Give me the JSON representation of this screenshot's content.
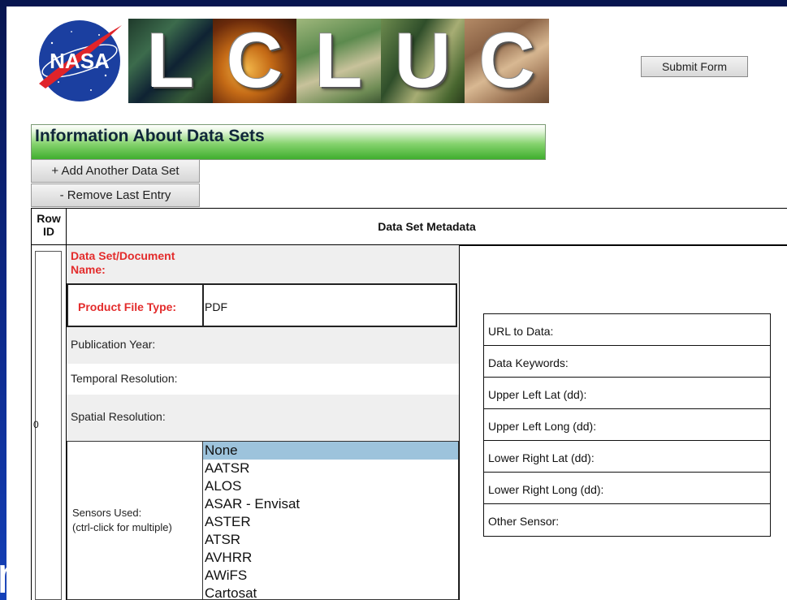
{
  "header": {
    "logo_text": "NASA",
    "banner_letters": [
      "L",
      "C",
      "L",
      "U",
      "C"
    ],
    "submit_label": "Submit Form"
  },
  "section": {
    "title": "Information About Data Sets",
    "add_label": "+ Add Another Data Set",
    "remove_label": "- Remove Last Entry"
  },
  "table": {
    "rowid_header": "Row ID",
    "meta_header": "Data Set Metadata",
    "row_id": "0",
    "fields": {
      "name_label": "Data Set/Document Name:",
      "file_type_label": "Product File Type:",
      "file_type_value": "PDF",
      "pub_year_label": "Publication Year:",
      "temporal_label": "Temporal Resolution:",
      "spatial_label": "Spatial Resolution:",
      "sensors_label": "Sensors Used:",
      "sensors_hint": "(ctrl-click for multiple)"
    },
    "sensors": [
      "None",
      "AATSR",
      "ALOS",
      "ASAR - Envisat",
      "ASTER",
      "ATSR",
      "AVHRR",
      "AWiFS",
      "Cartosat"
    ],
    "selected_sensor": "None",
    "right_fields": [
      "URL to Data:",
      "Data Keywords:",
      "Upper Left Lat (dd):",
      "Upper Left Long (dd):",
      "Lower Right Lat (dd):",
      "Lower Right Long (dd):",
      "Other Sensor:"
    ]
  },
  "colors": {
    "background": "#0b1e6e",
    "required_label": "#e32c2c",
    "header_green": "#3fae2e",
    "selection": "#9dc3dc"
  }
}
